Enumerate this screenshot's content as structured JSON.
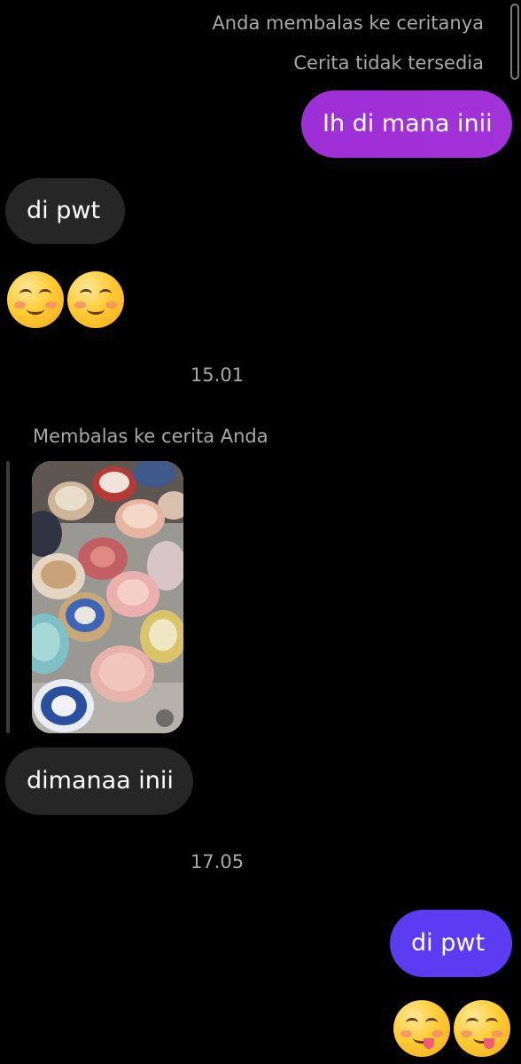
{
  "thread": {
    "reply_to_their_story": "Anda membalas ke ceritanya",
    "story_unavailable": "Cerita tidak tersedia",
    "msg_out_1": "Ih di mana inii",
    "msg_in_1": "di pwt",
    "emoji_in_1": "relieved-smiling-face-emoji",
    "time_1": "15.01",
    "replied_to_your_story": "Membalas ke cerita Anda",
    "story_image": "story-photo-ceramic-plates",
    "msg_in_2": "dimanaa inii",
    "time_2": "17.05",
    "msg_out_2": "di pwt",
    "emoji_out_2": "face-savoring-food-emoji"
  },
  "colors": {
    "background": "#000000",
    "incoming_bubble": "#262626",
    "outgoing_bubble_1": "#9d2fd6",
    "outgoing_bubble_2": "#5b3cf0",
    "meta_text": "#a8a8a8"
  }
}
